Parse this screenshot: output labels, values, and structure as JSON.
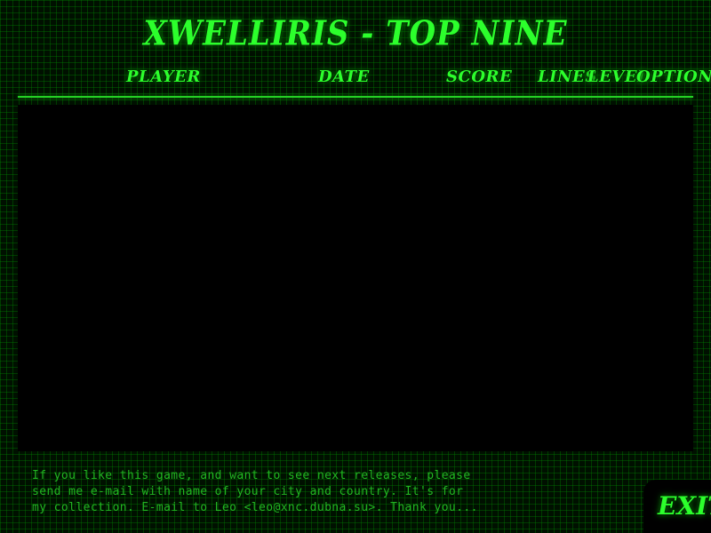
{
  "title": "XWELLIRIS - TOP NINE",
  "columns": {
    "player": "PLAYER",
    "date": "DATE",
    "score": "SCORE",
    "lines": "LINES",
    "level": "LEVEL",
    "options": "OPTIONS"
  },
  "scores": [],
  "footer": {
    "message": "If you like this game, and want to see next releases, please\nsend me e-mail with name of your city and country. It's for\nmy collection. E-mail to Leo <leo@xnc.dubna.su>. Thank you..."
  },
  "exit_label": "EXIT",
  "colors": {
    "accent": "#2cff2c",
    "background": "#001000",
    "grid": "#008c00",
    "panel": "#000000",
    "footer_text": "#22b522"
  }
}
